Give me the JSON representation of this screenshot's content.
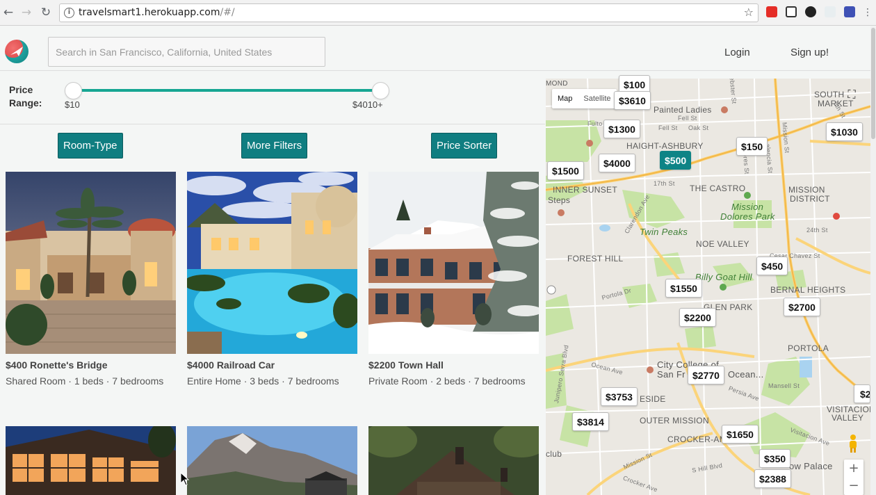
{
  "browser": {
    "url_host": "travelsmart1.herokuapp.com",
    "url_path": "/#/"
  },
  "header": {
    "search_placeholder": "Search in San Francisco, California, United States",
    "login": "Login",
    "signup": "Sign up!"
  },
  "price_range": {
    "label": "Price Range:",
    "min_label": "$10",
    "max_label": "$4010+"
  },
  "filters": {
    "room_type": "Room-Type",
    "more": "More Filters",
    "price_sorter": "Price Sorter"
  },
  "listings": [
    {
      "title": "$400 Ronette's Bridge",
      "sub": "Shared Room · 1 beds · 7 bedrooms"
    },
    {
      "title": "$4000 Railroad Car",
      "sub": "Entire Home · 3 beds · 7 bedrooms"
    },
    {
      "title": "$2200 Town Hall",
      "sub": "Private Room · 2 beds · 7 bedrooms"
    }
  ],
  "map": {
    "type_map": "Map",
    "type_satellite": "Satellite",
    "pins": [
      "$100",
      "$3610",
      "$1300",
      "$1030",
      "$150",
      "$500",
      "$4000",
      "$1500",
      "$450",
      "$1550",
      "$2700",
      "$2200",
      "$2770",
      "$3753",
      "$3814",
      "$1650",
      "$350",
      "$2388",
      "$2"
    ],
    "labels": {
      "painted_ladies": "Painted Ladies",
      "haight": "HAIGHT-ASHBURY",
      "inner_sunset": "INNER SUNSET",
      "castro": "THE CASTRO",
      "mission": "MISSION",
      "district": "DISTRICT",
      "mission_park": "Mission",
      "dolores_park": "Dolores Park",
      "twin_peaks": "Twin Peaks",
      "noe_valley": "NOE VALLEY",
      "forest_hill": "FOREST HILL",
      "billy_goat": "Billy Goat Hill",
      "bernal": "BERNAL HEIGHTS",
      "glen_park": "GLEN PARK",
      "portola": "PORTOLA",
      "city_college": "City College of",
      "san_fr": "San Fr",
      "ocean": "Ocean...",
      "eside": "ESIDE",
      "outer_mission": "OUTER MISSION",
      "crocker": "CROCKER-AM",
      "visitacion": "VISITACION",
      "valley": "VALLEY",
      "south": "SOUTH",
      "market": "MARKET",
      "steps": "Steps",
      "club": "club",
      "palace": "ow Palace",
      "mond": "MOND",
      "cesar": "Cesar Chavez St",
      "fell": "Fell St",
      "oak": "Oak St",
      "portola_dr": "Portola Dr",
      "ocean_ave": "Ocean Ave",
      "persia": "Persia Ave",
      "mission_st": "Mission St",
      "mansell": "Mansell St",
      "st24": "24th St",
      "st17": "17th St",
      "junipero": "Junipero Serra Blvd",
      "visitacion_ave": "Visitacion Ave",
      "geneva": "S Hill Blvd",
      "crocker_ave": "Crocker Ave",
      "clarendon": "Clarendon Ave",
      "st8": "8th St",
      "dolores": "Dolores St",
      "valencia": "alencia St",
      "mission_st2": "Mission St",
      "fulton": "Fulto",
      "webster": "ebster St"
    }
  },
  "colors": {
    "accent": "#107e81",
    "slider": "#16a693"
  }
}
